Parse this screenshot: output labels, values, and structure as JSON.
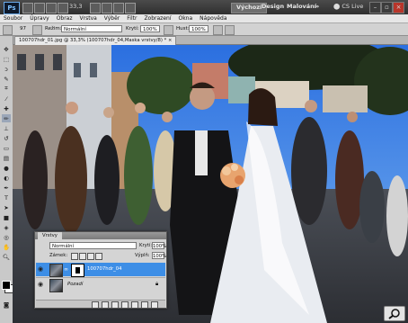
{
  "appbar": {
    "logo": "Ps",
    "zoom": "33,3",
    "workspaces": [
      "Výchozí",
      "Design",
      "Malování"
    ],
    "active_workspace": "Výchozí",
    "cs_live": "CS Live",
    "icons": [
      "bridge-icon",
      "mini-bridge-icon",
      "grid-icon",
      "zoom-icon",
      "arrange-icon"
    ]
  },
  "menu": [
    "Soubor",
    "Úpravy",
    "Obraz",
    "Vrstva",
    "Výběr",
    "Filtr",
    "Zobrazení",
    "Okna",
    "Nápověda"
  ],
  "options": {
    "brush_size": "97",
    "mode_label": "Režim:",
    "mode_value": "Normální",
    "opacity_label": "Krytí:",
    "opacity_value": "100%",
    "flow_label": "Hust:",
    "flow_value": "100%"
  },
  "tabs": {
    "inactive": "100707hdr_01.jpg @ 33,3% (100707hdr_04,Maska vrstvy/8) *"
  },
  "layers": {
    "panel_tab": "Vrstvy",
    "blend_mode": "Normální",
    "opacity_label": "Krytí:",
    "opacity_value": "100%",
    "lock_label": "Zámek:",
    "fill_label": "Výplň:",
    "fill_value": "100%",
    "rows": [
      {
        "name": "100707hdr_04",
        "selected": true
      },
      {
        "name": "Pozadí",
        "selected": false
      }
    ]
  },
  "colors": {
    "selected_layer": "#3d8ee6",
    "accent_blue": "#2d6fd3"
  }
}
